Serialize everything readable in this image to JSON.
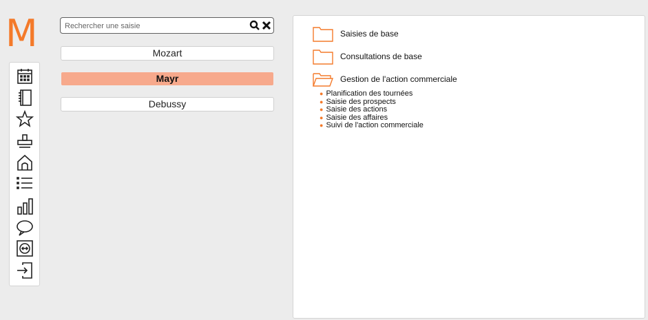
{
  "logo": {
    "letter": "M",
    "color": "#f47a2a"
  },
  "iconbar": {
    "icons": [
      "calendar-icon",
      "address-book-icon",
      "star-icon",
      "stamp-icon",
      "home-icon",
      "list-icon",
      "bar-chart-icon",
      "speech-bubble-icon",
      "transfer-icon",
      "logout-icon"
    ]
  },
  "search": {
    "placeholder": "Rechercher une saisie",
    "value": ""
  },
  "databases": [
    {
      "label": "Mozart",
      "active": false
    },
    {
      "label": "Mayr",
      "active": true
    },
    {
      "label": "Debussy",
      "active": false
    }
  ],
  "menu": {
    "folders": [
      {
        "label": "Saisies de base",
        "open": false
      },
      {
        "label": "Consultations de base",
        "open": false
      },
      {
        "label": "Gestion de l'action commerciale",
        "open": true
      }
    ],
    "items": [
      "Planification des tournées",
      "Saisie des prospects",
      "Saisie des actions",
      "Saisie des affaires",
      "Suivi de l'action commerciale"
    ]
  },
  "colors": {
    "accent": "#f47a2a",
    "active_button": "#f7a98c",
    "background": "#ececec"
  }
}
